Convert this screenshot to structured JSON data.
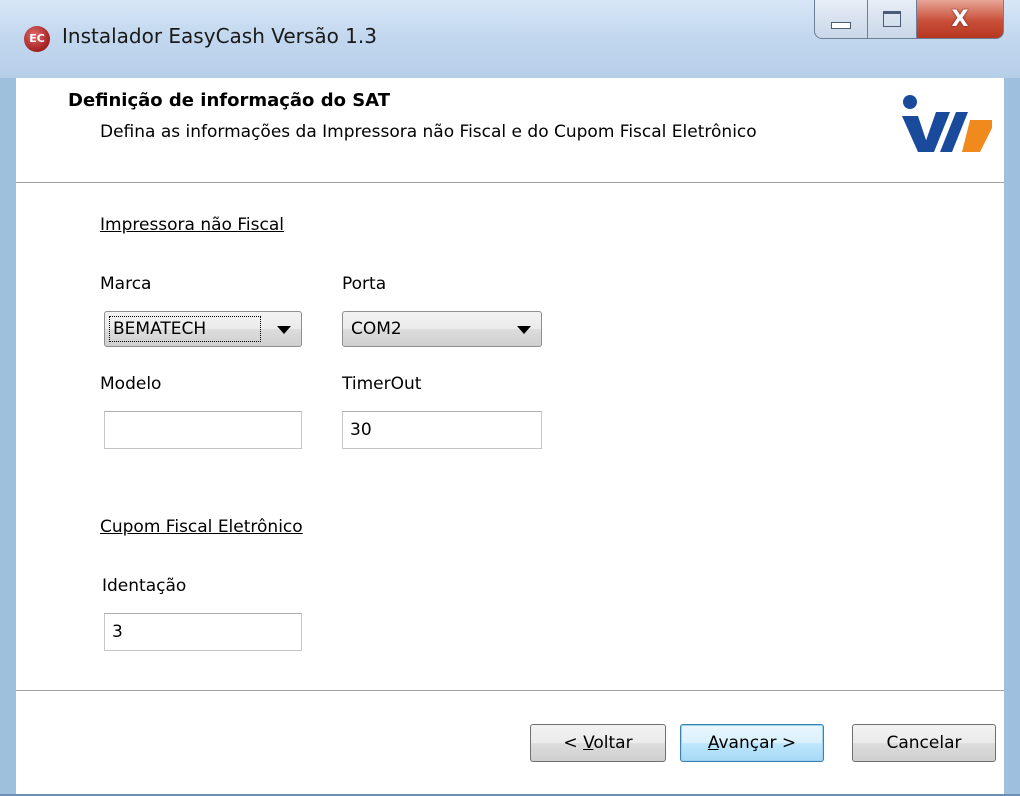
{
  "window": {
    "title": "Instalador EasyCash Versão 1.3",
    "app_icon_text": "EC",
    "close_glyph": "X"
  },
  "header": {
    "title": "Definição de informação do SAT",
    "subtitle": "Defina as informações da Impressora não Fiscal e do Cupom Fiscal Eletrônico",
    "logo_icon": "company-logo"
  },
  "printer_section": {
    "label": "Impressora não Fiscal",
    "marca_label": "Marca",
    "marca_value": "BEMATECH",
    "porta_label": "Porta",
    "porta_value": "COM2",
    "modelo_label": "Modelo",
    "modelo_value": "",
    "timerout_label": "TimerOut",
    "timerout_value": "30"
  },
  "cfe_section": {
    "label": "Cupom Fiscal Eletrônico",
    "identacao_label": "Identação",
    "identacao_value": "3"
  },
  "buttons": {
    "back_prefix": "< ",
    "back_mnemonic": "V",
    "back_rest": "oltar",
    "next_mnemonic": "A",
    "next_rest": "vançar >",
    "cancel": "Cancelar"
  },
  "colors": {
    "titlebar": "#c3d8ef",
    "close_button": "#c9503a",
    "logo_blue": "#1a4a9c",
    "logo_orange": "#f08a1c",
    "default_button_border": "#3c7fb1"
  }
}
